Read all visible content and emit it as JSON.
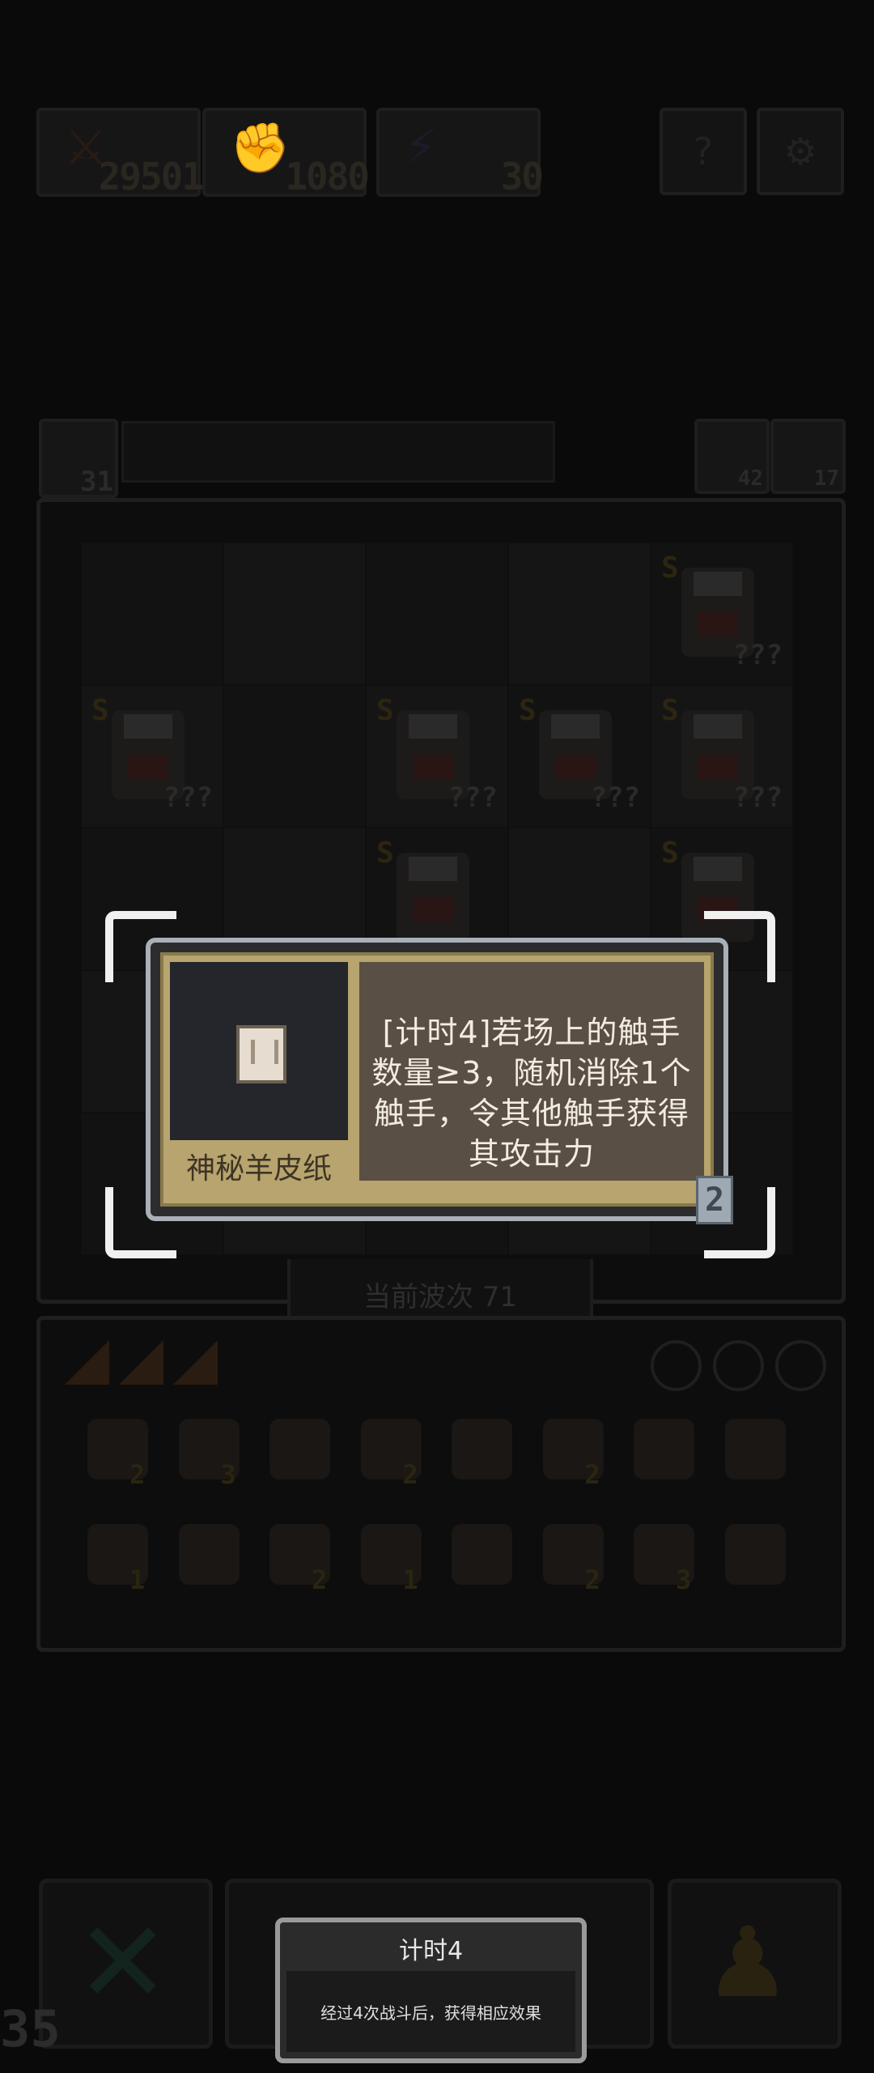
{
  "resources": [
    {
      "name": "attack",
      "icon": "sword-icon",
      "glyph": "⚔",
      "value": "29501"
    },
    {
      "name": "hand",
      "icon": "fist-icon",
      "glyph": "✊",
      "value": "1080"
    },
    {
      "name": "energy",
      "icon": "lightning-icon",
      "glyph": "⚡",
      "value": "30"
    }
  ],
  "top_buttons": [
    {
      "name": "help-button",
      "glyph": "?"
    },
    {
      "name": "settings-button",
      "glyph": "⚙"
    }
  ],
  "energy_counter": "31",
  "side_counters": [
    {
      "name": "refresh-counter",
      "value": "42"
    },
    {
      "name": "key-counter",
      "value": "17"
    }
  ],
  "units_rank": "S",
  "units_hidden_label": "???",
  "wave_label": "当前波次 71",
  "inventory_counts": [
    "2",
    "3",
    "",
    "2",
    "",
    "2",
    "",
    "",
    "1",
    "",
    "2",
    "1",
    "",
    "2",
    "3",
    ""
  ],
  "selected_item": {
    "name": "神秘羊皮纸",
    "description": "[计时4]若场上的触手数量≥3，随机消除1个触手，令其他触手获得其攻击力",
    "level": "2"
  },
  "tooltip": {
    "title": "计时4",
    "body": "经过4次战斗后，获得相应效果"
  },
  "page_number": "35",
  "colors": {
    "popup_border": "#a9b0b8",
    "popup_frame": "#b7a46e",
    "description_bg": "#5a4f45",
    "icon_bg": "#25262b"
  }
}
